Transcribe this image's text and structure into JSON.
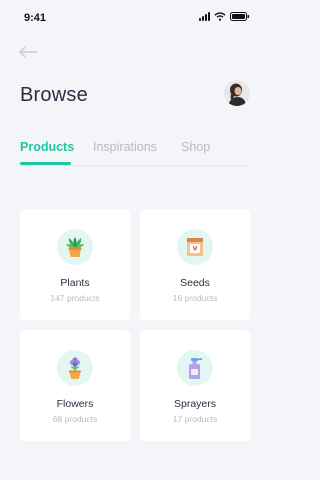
{
  "status_bar": {
    "time": "9:41"
  },
  "header": {
    "title": "Browse"
  },
  "tabs": [
    {
      "label": "Products",
      "active": true
    },
    {
      "label": "Inspirations",
      "active": false
    },
    {
      "label": "Shop",
      "active": false
    }
  ],
  "categories": [
    {
      "name": "Plants",
      "count": "147 products",
      "icon": "potted-plant-icon"
    },
    {
      "name": "Seeds",
      "count": "16 products",
      "icon": "seed-packet-icon"
    },
    {
      "name": "Flowers",
      "count": "68 products",
      "icon": "flower-pot-icon"
    },
    {
      "name": "Sprayers",
      "count": "17 products",
      "icon": "spray-bottle-icon"
    }
  ],
  "colors": {
    "accent": "#23c4a1",
    "icon_bg": "#e3f7f2",
    "background": "#f4f5f9",
    "muted": "#b7bac6"
  }
}
